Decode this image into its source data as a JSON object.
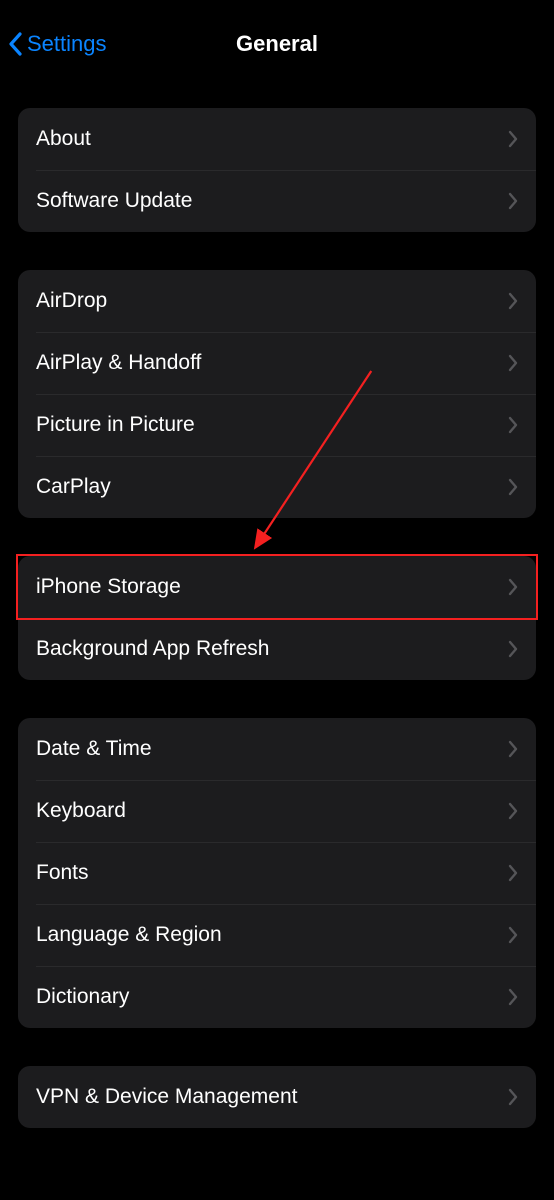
{
  "nav": {
    "back_label": "Settings",
    "title": "General"
  },
  "groups": [
    {
      "id": "about_group",
      "items": [
        {
          "id": "about",
          "label": "About"
        },
        {
          "id": "software-update",
          "label": "Software Update"
        }
      ]
    },
    {
      "id": "connectivity_group",
      "items": [
        {
          "id": "airdrop",
          "label": "AirDrop"
        },
        {
          "id": "airplay-handoff",
          "label": "AirPlay & Handoff"
        },
        {
          "id": "pip",
          "label": "Picture in Picture"
        },
        {
          "id": "carplay",
          "label": "CarPlay"
        }
      ]
    },
    {
      "id": "storage_group",
      "items": [
        {
          "id": "iphone-storage",
          "label": "iPhone Storage"
        },
        {
          "id": "background-refresh",
          "label": "Background App Refresh"
        }
      ]
    },
    {
      "id": "locale_group",
      "items": [
        {
          "id": "date-time",
          "label": "Date & Time"
        },
        {
          "id": "keyboard",
          "label": "Keyboard"
        },
        {
          "id": "fonts",
          "label": "Fonts"
        },
        {
          "id": "language-region",
          "label": "Language & Region"
        },
        {
          "id": "dictionary",
          "label": "Dictionary"
        }
      ]
    },
    {
      "id": "vpn_group",
      "items": [
        {
          "id": "vpn-device-mgmt",
          "label": "VPN & Device Management"
        }
      ]
    }
  ],
  "annotation": {
    "highlight_target": "iphone-storage",
    "color": "#f42020"
  }
}
